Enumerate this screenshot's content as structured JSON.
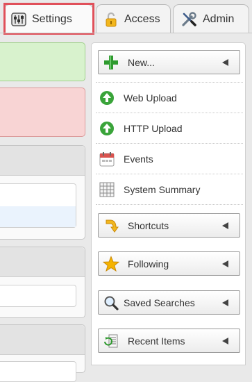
{
  "tabs": {
    "settings": {
      "label": "Settings",
      "icon": "sliders-icon"
    },
    "access": {
      "label": "Access",
      "icon": "padlock-icon"
    },
    "admin": {
      "label": "Admin",
      "icon": "wrench-screwdriver-icon"
    }
  },
  "menu": {
    "new": {
      "label": "New...",
      "icon": "green-plus-icon"
    },
    "web_upload": {
      "label": "Web Upload",
      "icon": "green-up-arrow-icon"
    },
    "http_upload": {
      "label": "HTTP Upload",
      "icon": "green-up-arrow-icon"
    },
    "events": {
      "label": "Events",
      "icon": "calendar-icon"
    },
    "system_summary": {
      "label": "System Summary",
      "icon": "grid-icon"
    },
    "shortcuts": {
      "label": "Shortcuts",
      "icon": "shortcut-arrow-icon"
    },
    "following": {
      "label": "Following",
      "icon": "star-icon"
    },
    "saved_searches": {
      "label": "Saved Searches",
      "icon": "magnifier-icon"
    },
    "recent_items": {
      "label": "Recent Items",
      "icon": "recent-list-icon"
    }
  },
  "colors": {
    "focus": "#e0505a",
    "success_panel": "#d8f2cd",
    "error_panel": "#f8d4d4",
    "green_icon": "#3aa43a"
  }
}
